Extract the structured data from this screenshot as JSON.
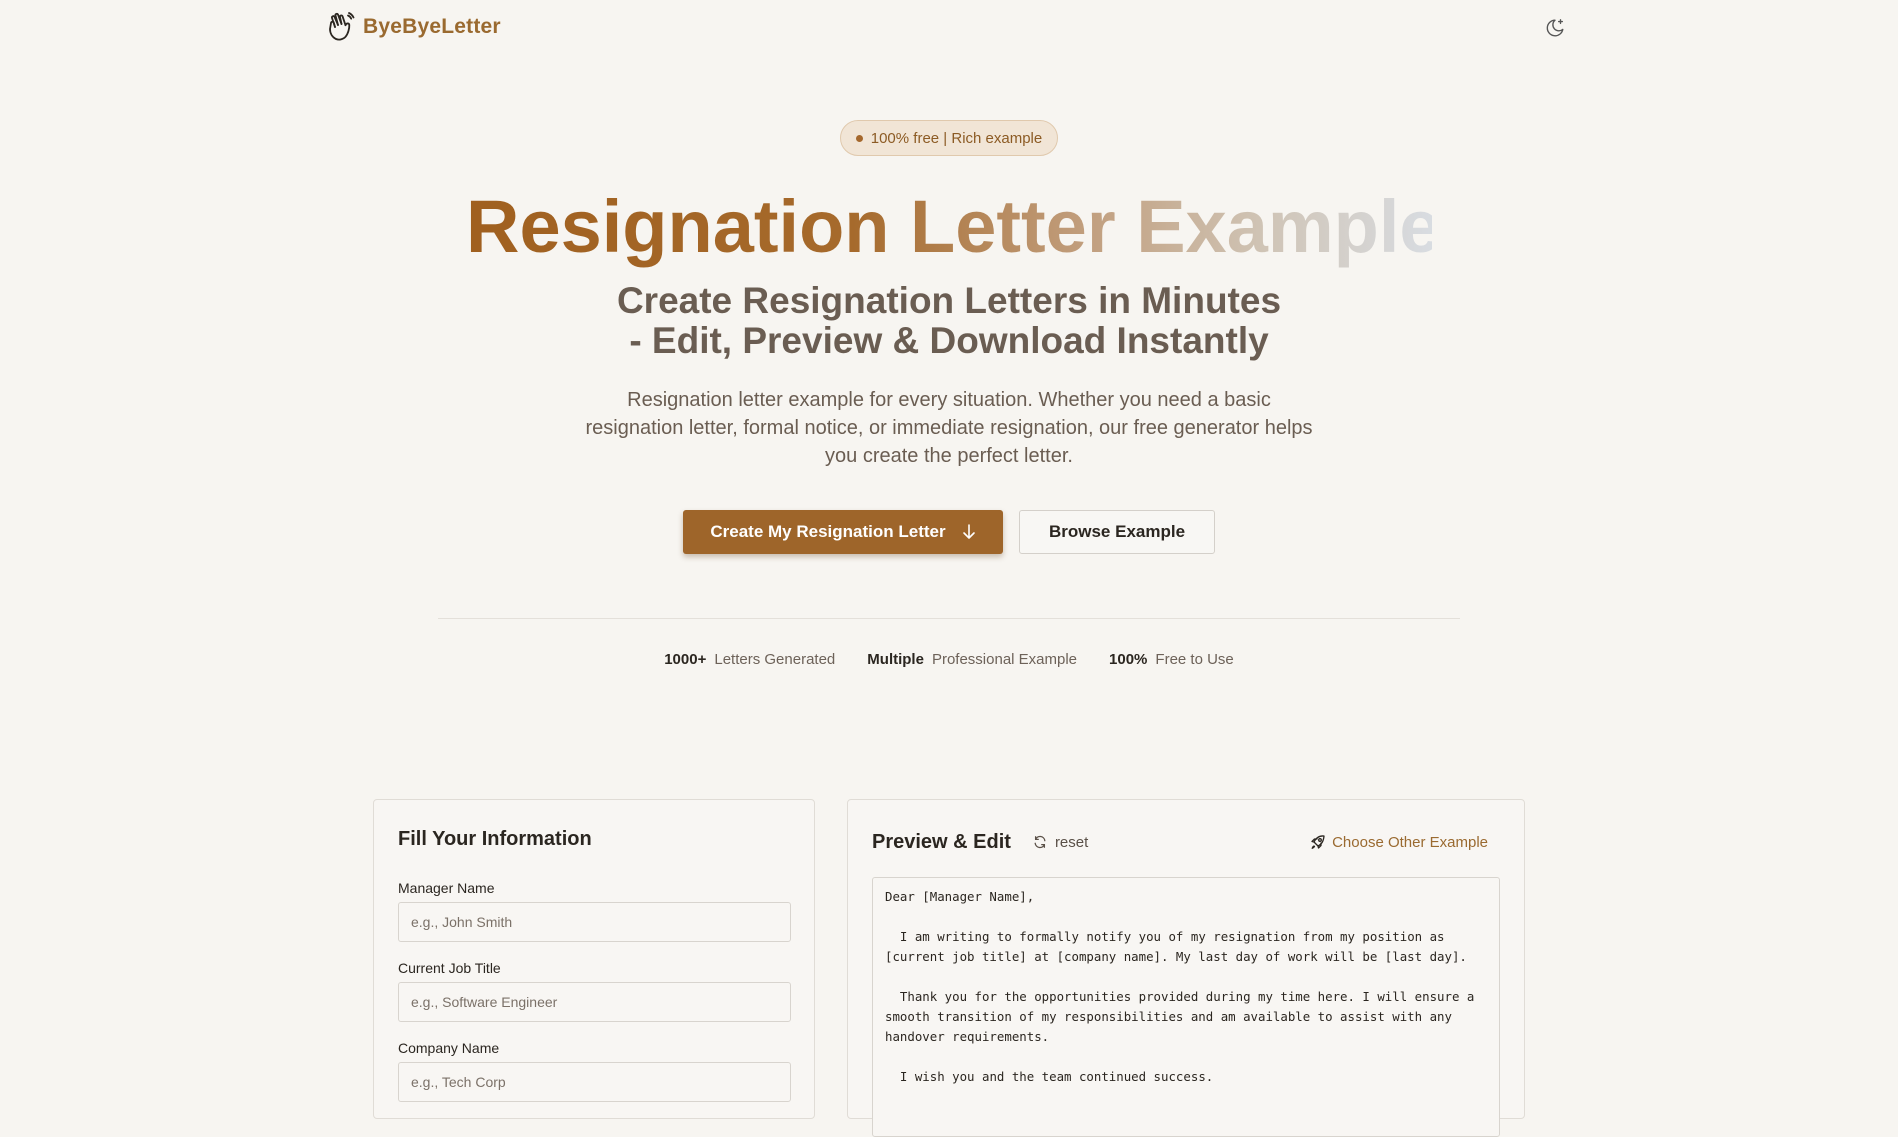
{
  "header": {
    "logo_text": "ByeByeLetter",
    "logo_icon": "waving-hand-icon",
    "theme_toggle_icon": "moon-sparkle-icon"
  },
  "hero": {
    "badge": "100% free | Rich example",
    "title": "Resignation Letter Example",
    "subtitle_line1": "Create Resignation Letters in Minutes",
    "subtitle_line2": "- Edit, Preview & Download Instantly",
    "description": "Resignation letter example for every situation. Whether you need a basic resignation letter, formal notice, or immediate resignation, our free generator helps you create the perfect letter.",
    "primary_button": "Create My Resignation Letter",
    "primary_button_icon": "arrow-down-icon",
    "secondary_button": "Browse Example"
  },
  "stats": [
    {
      "value": "1000+",
      "label": "Letters Generated"
    },
    {
      "value": "Multiple",
      "label": "Professional Example"
    },
    {
      "value": "100%",
      "label": "Free to Use"
    }
  ],
  "form": {
    "title": "Fill Your Information",
    "fields": [
      {
        "label": "Manager Name",
        "placeholder": "e.g., John Smith",
        "value": ""
      },
      {
        "label": "Current Job Title",
        "placeholder": "e.g., Software Engineer",
        "value": ""
      },
      {
        "label": "Company Name",
        "placeholder": "e.g., Tech Corp",
        "value": ""
      }
    ]
  },
  "preview": {
    "title": "Preview & Edit",
    "reset_label": "reset",
    "reset_icon": "refresh-icon",
    "choose_label": "Choose Other Example",
    "choose_icon": "rocket-icon",
    "letter": "Dear [Manager Name],\n\n  I am writing to formally notify you of my resignation from my position as [current job title] at [company name]. My last day of work will be [last day].\n\n  Thank you for the opportunities provided during my time here. I will ensure a smooth transition of my responsibilities and am available to assist with any handover requirements.\n\n  I wish you and the team continued success."
  },
  "colors": {
    "accent": "#9e652a",
    "background": "#f7f5f1",
    "badge_bg": "#f1e5d6",
    "text": "#2b2620"
  }
}
